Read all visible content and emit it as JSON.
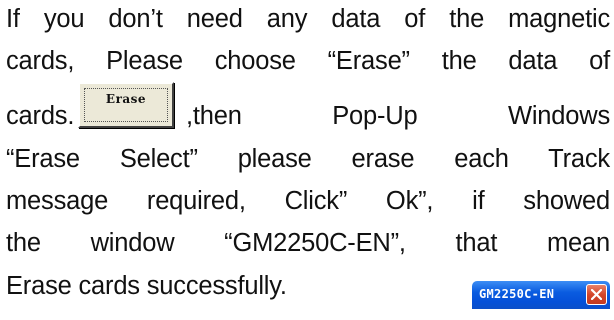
{
  "paragraph": {
    "line1": "If you don’t need any data of the magnetic",
    "line2": "cards, Please choose “Erase” the data of",
    "line3_start": "cards.",
    "line3_end": ",then Pop-Up Windows",
    "line4": "“Erase Select” please erase each Track",
    "line5": "message required, Click” Ok”, if showed",
    "line6": "the window “GM2250C-EN”, that mean",
    "line7": "Erase cards successfully."
  },
  "erase_button": {
    "label": "Erase"
  },
  "window_titlebar": {
    "title": "GM2250C-EN",
    "close_icon": "close-icon"
  },
  "colors": {
    "titlebar_blue": "#0a5ce0",
    "close_red": "#d4452a",
    "button_face": "#ece9d8"
  }
}
